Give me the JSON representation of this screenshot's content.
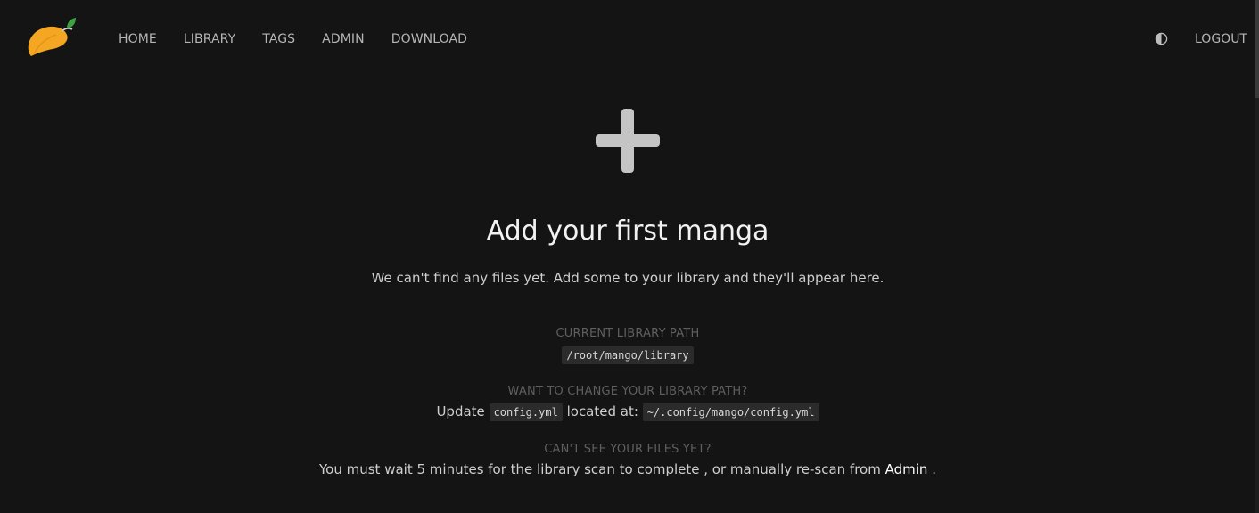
{
  "nav": {
    "logo_icon": "mango-logo-icon",
    "items": [
      {
        "label": "HOME"
      },
      {
        "label": "LIBRARY"
      },
      {
        "label": "TAGS"
      },
      {
        "label": "ADMIN"
      },
      {
        "label": "DOWNLOAD"
      }
    ],
    "theme_icon": "contrast-icon",
    "logout_label": "LOGOUT"
  },
  "empty_state": {
    "icon": "plus-icon",
    "title": "Add your first manga",
    "subtitle": "We can't find any files yet. Add some to your library and they'll appear here."
  },
  "library_path": {
    "label": "CURRENT LIBRARY PATH",
    "value": "/root/mango/library"
  },
  "change_path": {
    "label": "WANT TO CHANGE YOUR LIBRARY PATH?",
    "prefix": "Update",
    "config_file": "config.yml",
    "middle": "located at:",
    "config_path": "~/.config/mango/config.yml"
  },
  "files_help": {
    "label": "CAN'T SEE YOUR FILES YET?",
    "text": "You must wait 5 minutes for the library scan to complete , or manually re-scan from",
    "link": "Admin",
    "suffix": "."
  },
  "colors": {
    "background": "#141414",
    "logo_orange": "#f5a623",
    "leaf_green": "#3ea243",
    "muted_label": "#5f5f5f"
  }
}
